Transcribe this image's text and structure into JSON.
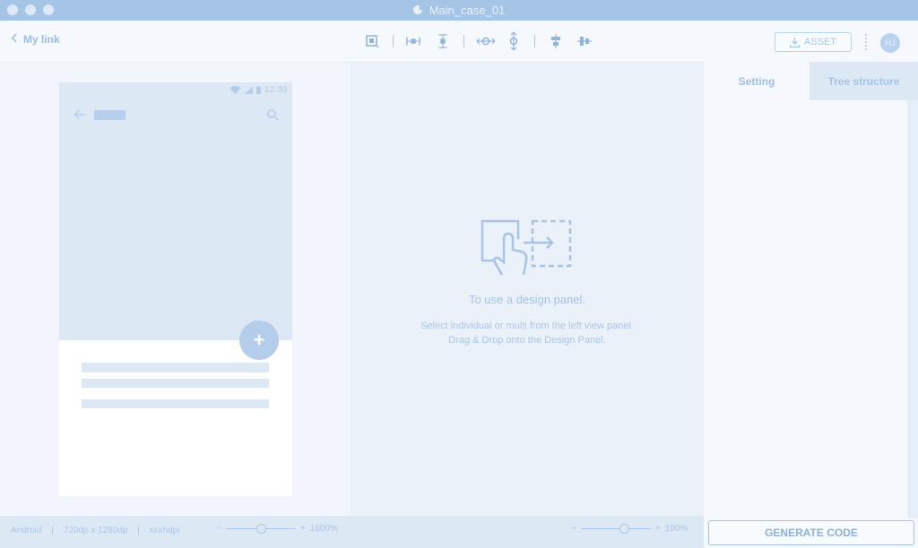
{
  "window": {
    "title": "Main_case_01"
  },
  "toolbar": {
    "back_label": "My link",
    "asset_label": "ASSET",
    "avatar_initials": "HJ"
  },
  "tools": [
    "select-area-icon",
    "horizontal-spacing-icon",
    "vertical-spacing-icon",
    "distribute-horizontal-icon",
    "distribute-vertical-icon",
    "align-center-vertical-icon",
    "align-center-horizontal-icon"
  ],
  "device_preview": {
    "status_time": "12:30"
  },
  "design_panel": {
    "title": "To use a design panel.",
    "line1": "Select individual or multi from the left view panel.",
    "line2": "Drag & Drop onto the Design Panel."
  },
  "right_panel": {
    "tabs": [
      {
        "label": "Setting",
        "active": true
      },
      {
        "label": "Tree structure",
        "active": false
      }
    ],
    "generate_label": "GENERATE CODE"
  },
  "footer": {
    "platform": "Android",
    "resolution": "720dp x 1280dp",
    "density": "xxxhdpi",
    "left_zoom": "1600%",
    "right_zoom": "100%",
    "minus": "−",
    "plus": "+"
  },
  "colors": {
    "accent": "#a6c4e6",
    "panel": "#f2f6fc",
    "text": "#8fb4dd"
  }
}
